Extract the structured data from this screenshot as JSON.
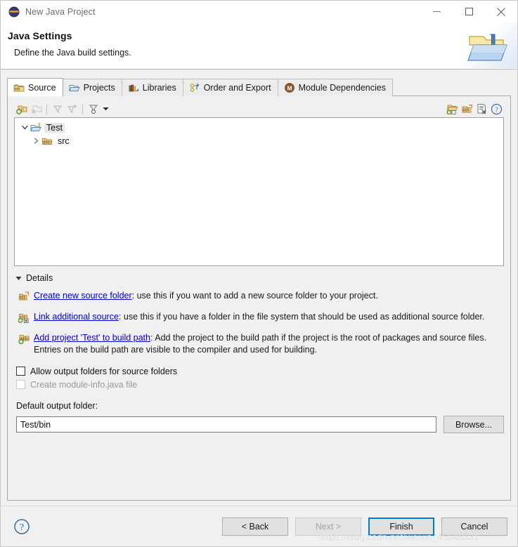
{
  "window": {
    "title": "New Java Project",
    "icon": "eclipse-icon",
    "controls": {
      "minimize": "minimize-icon",
      "maximize": "maximize-icon",
      "close": "close-icon"
    }
  },
  "header": {
    "title": "Java Settings",
    "subtitle": "Define the Java build settings.",
    "art_icon": "java-project-folder-icon"
  },
  "tabs": [
    {
      "label": "Source",
      "icon": "source-folder-icon",
      "active": true
    },
    {
      "label": "Projects",
      "icon": "open-folder-icon",
      "active": false
    },
    {
      "label": "Libraries",
      "icon": "libraries-books-icon",
      "active": false
    },
    {
      "label": "Order and Export",
      "icon": "order-export-icon",
      "active": false
    },
    {
      "label": "Module Dependencies",
      "icon": "module-m-icon",
      "active": false
    }
  ],
  "tree_toolbar": {
    "left_buttons": [
      {
        "name": "add-source-folder-icon",
        "enabled": true
      },
      {
        "name": "remove-source-folder-icon",
        "enabled": false
      },
      {
        "name": "filter-icon",
        "enabled": false
      },
      {
        "name": "add-filter-icon",
        "enabled": false
      },
      {
        "name": "configure-filter-icon",
        "enabled": true
      },
      {
        "name": "toolbar-dropdown-caret-icon",
        "enabled": true
      }
    ],
    "right_buttons": [
      {
        "name": "link-source-icon"
      },
      {
        "name": "new-source-folder-icon"
      },
      {
        "name": "remove-entry-icon"
      },
      {
        "name": "help-icon"
      }
    ]
  },
  "tree": {
    "nodes": [
      {
        "label": "Test",
        "icon": "project-folder-icon",
        "expanded": true,
        "selected": true,
        "twisty": "chevron-down-icon",
        "depth": 0
      },
      {
        "label": "src",
        "icon": "source-package-folder-icon",
        "expanded": false,
        "selected": false,
        "twisty": "chevron-right-icon",
        "depth": 1
      }
    ]
  },
  "details": {
    "section_label": "Details",
    "section_twisty": "triangle-down-icon",
    "links": [
      {
        "icon": "create-source-folder-icon",
        "link_text": "Create new source folder",
        "description": ": use this if you want to add a new source folder to your project."
      },
      {
        "icon": "link-additional-source-icon",
        "link_text": "Link additional source",
        "description": ": use this if you have a folder in the file system that should be used as additional source folder."
      },
      {
        "icon": "add-project-build-path-icon",
        "link_text": "Add project 'Test' to build path",
        "description": ": Add the project to the build path if the project is the root of packages and source files. Entries on the build path are visible to the compiler and used for building."
      }
    ]
  },
  "options": [
    {
      "label": "Allow output folders for source folders",
      "checked": false,
      "enabled": true
    },
    {
      "label": "Create module-info.java file",
      "checked": false,
      "enabled": false
    }
  ],
  "output": {
    "label": "Default output folder:",
    "value": "Test/bin",
    "browse_label": "Browse..."
  },
  "footer": {
    "help_icon": "help-question-icon",
    "buttons": [
      {
        "label": "< Back",
        "enabled": true,
        "default": false
      },
      {
        "label": "Next >",
        "enabled": false,
        "default": false
      },
      {
        "label": "Finish",
        "enabled": true,
        "default": true
      },
      {
        "label": "Cancel",
        "enabled": true,
        "default": false
      }
    ]
  },
  "watermark": "https://blog.csdn.net/weixin_45048331",
  "colors": {
    "accent": "#0078d7",
    "link": "#0000c8",
    "dialog_bg": "#f0f0f0",
    "field_bg": "#ffffff"
  }
}
